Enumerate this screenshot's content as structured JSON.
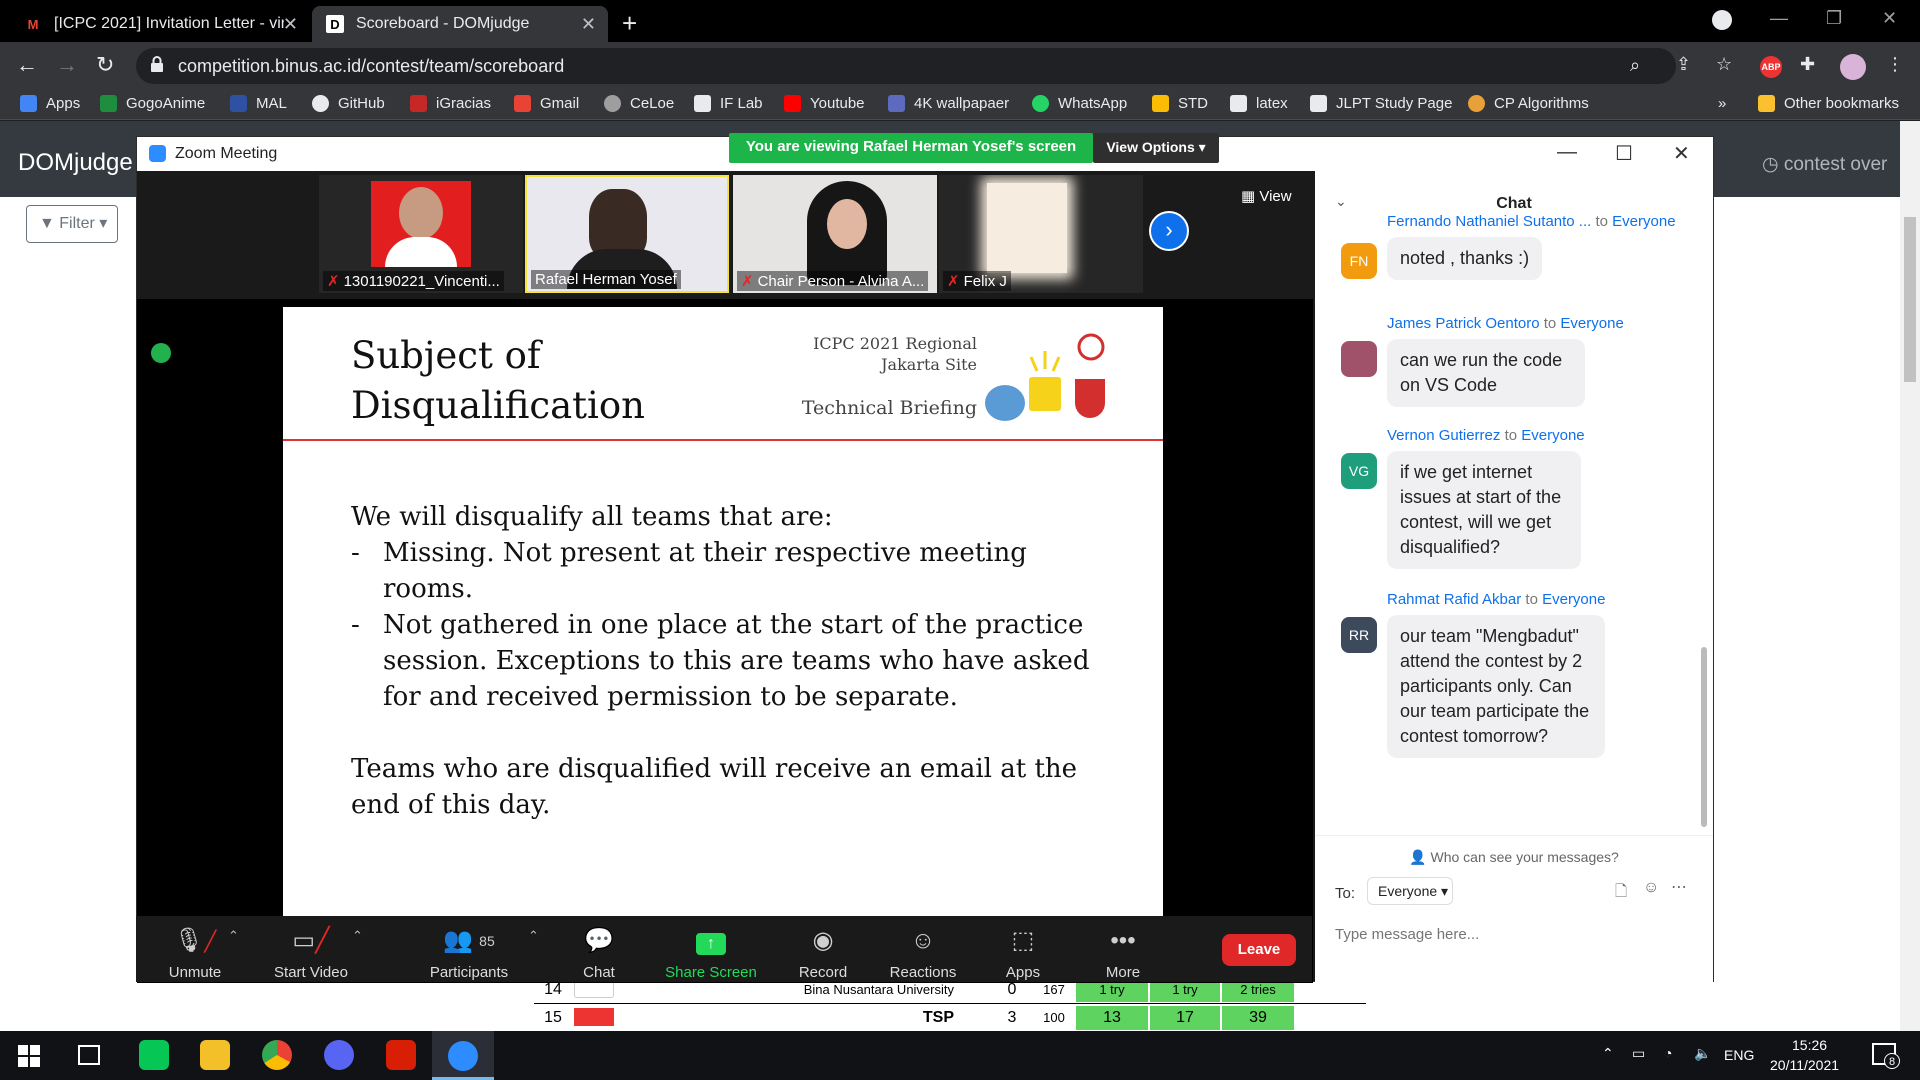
{
  "browser": {
    "tabs": [
      {
        "title": "[ICPC 2021] Invitation Letter - vin",
        "icon": "gmail-icon"
      },
      {
        "title": "Scoreboard - DOMjudge",
        "icon": "domjudge-icon"
      }
    ],
    "url": "competition.binus.ac.id/contest/team/scoreboard",
    "extension_badge": "ABP",
    "bookmarks": [
      {
        "label": "Apps",
        "icon": "apps-grid-icon",
        "color": "#4285f4"
      },
      {
        "label": "GogoAnime",
        "icon": "gogoanime-icon",
        "color": "#1e8e3e"
      },
      {
        "label": "MAL",
        "icon": "mal-icon",
        "color": "#2e51a2"
      },
      {
        "label": "GitHub",
        "icon": "github-icon",
        "color": "#e8eaed"
      },
      {
        "label": "iGracias",
        "icon": "igracias-icon",
        "color": "#c62828"
      },
      {
        "label": "Gmail",
        "icon": "gmail-icon",
        "color": "#ea4335"
      },
      {
        "label": "CeLoe",
        "icon": "celoe-icon",
        "color": "#9e9e9e"
      },
      {
        "label": "IF Lab",
        "icon": "iflab-icon",
        "color": "#e8eaed"
      },
      {
        "label": "Youtube",
        "icon": "youtube-icon",
        "color": "#ff0000"
      },
      {
        "label": "4K wallpapaer",
        "icon": "wallpaper-icon",
        "color": "#5c6bc0"
      },
      {
        "label": "WhatsApp",
        "icon": "whatsapp-icon",
        "color": "#25d366"
      },
      {
        "label": "STD",
        "icon": "drive-icon",
        "color": "#fbbc04"
      },
      {
        "label": "latex",
        "icon": "latex-icon",
        "color": "#e8eaed"
      },
      {
        "label": "JLPT Study Page",
        "icon": "jlpt-icon",
        "color": "#e8eaed"
      },
      {
        "label": "CP Algorithms",
        "icon": "cp-algorithms-icon",
        "color": "#e8a03b"
      }
    ],
    "other_bookmarks": "Other bookmarks"
  },
  "domjudge": {
    "brand": "DOMjudge",
    "status": "contest over",
    "filter_label": "Filter",
    "rows": [
      {
        "rank": "14",
        "team": "",
        "affiliation": "Bina Nusantara University",
        "solved": "0",
        "time": "167",
        "cells": [
          "1 try",
          "1 try",
          "2 tries"
        ]
      },
      {
        "rank": "15",
        "team": "TSP",
        "affiliation": "",
        "solved": "3",
        "time": "100",
        "cells": [
          "13",
          "17",
          "39"
        ]
      }
    ],
    "cell_color": "#5fd35f"
  },
  "zoom": {
    "window_title": "Zoom Meeting",
    "banner": "You are viewing Rafael Herman Yosef's screen",
    "view_options": "View Options",
    "gallery_view_label": "View",
    "participants": [
      {
        "name": "1301190221_Vincenti...",
        "muted": true
      },
      {
        "name": "Rafael Herman Yosef",
        "muted": false
      },
      {
        "name": "Chair Person - Alvina A...",
        "muted": true
      },
      {
        "name": "Felix J",
        "muted": true
      }
    ],
    "slide": {
      "title_line1": "Subject of",
      "title_line2": "Disqualification",
      "org_line1": "ICPC 2021 Regional",
      "org_line2": "Jakarta Site",
      "subtitle": "Technical Briefing",
      "intro": "We will disqualify all teams that are:",
      "bullet1": "Missing. Not present at their respective meeting rooms.",
      "bullet2": "Not gathered in one place at the start of the practice session. Exceptions to this are teams who have asked for and received permission to be separate.",
      "closing": "Teams who are disqualified will receive an email at the end of this day."
    },
    "toolbar": {
      "unmute": "Unmute",
      "start_video": "Start Video",
      "participants": "Participants",
      "participants_count": "85",
      "chat": "Chat",
      "share_screen": "Share Screen",
      "record": "Record",
      "reactions": "Reactions",
      "apps": "Apps",
      "more": "More",
      "leave": "Leave"
    },
    "chat": {
      "title": "Chat",
      "messages": [
        {
          "sender": "Fernando Nathaniel Sutanto ...",
          "to": "to",
          "recipient": "Everyone",
          "initials": "FN",
          "color": "#f29b0f",
          "text": "noted , thanks :)"
        },
        {
          "sender": "James Patrick Oentoro",
          "to": "to",
          "recipient": "Everyone",
          "initials": "",
          "color": "#a0526a",
          "text": "can we run the code on VS Code"
        },
        {
          "sender": "Vernon Gutierrez",
          "to": "to",
          "recipient": "Everyone",
          "initials": "VG",
          "color": "#1f9e7e",
          "text": "if we get internet issues at start of the contest, will we get disqualified?"
        },
        {
          "sender": "Rahmat Rafid Akbar",
          "to": "to",
          "recipient": "Everyone",
          "initials": "RR",
          "color": "#3c4a5c",
          "text": "our team \"Mengbadut\" attend the contest by 2 participants only. Can our team participate the contest tomorrow?"
        }
      ],
      "who_can_see": "Who can see your messages?",
      "to_label": "To:",
      "to_value": "Everyone",
      "input_placeholder": "Type message here..."
    }
  },
  "taskbar": {
    "language": "ENG",
    "time": "15:26",
    "date": "20/11/2021",
    "notification_count": "8"
  }
}
